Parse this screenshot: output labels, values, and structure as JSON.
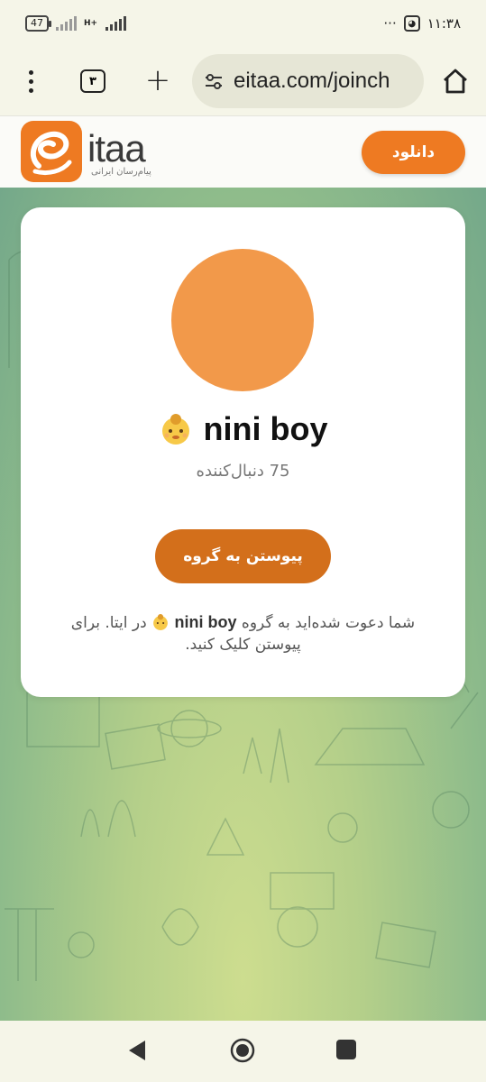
{
  "status_bar": {
    "battery": "47",
    "network_type": "H+",
    "time": "۱۱:۳۸",
    "more": "···"
  },
  "browser": {
    "tab_count": "۳",
    "url": "eitaa.com/joinch",
    "menu_icon": "more-vert-icon",
    "new_tab_icon": "plus-icon",
    "home_icon": "home-icon",
    "site_settings_icon": "tune-icon"
  },
  "site": {
    "logo_word": "itaa",
    "logo_tagline": "پیام‌رسان ایرانی",
    "download_label": "دانلود",
    "accent_color": "#ee7a22"
  },
  "group": {
    "name": "nini boy",
    "emoji_icon": "baby-emoji-icon",
    "avatar_color": "#f2994a",
    "members": "75 دنبال‌کننده",
    "join_label": "پیوستن به گروه",
    "join_color": "#d36f1b",
    "invite_prefix": "شما دعوت شده‌اید به گروه",
    "invite_suffix": "در ایتا. برای پیوستن کلیک کنید."
  },
  "navbar": {
    "back_icon": "back-triangle-icon",
    "home_icon": "home-circle-icon",
    "recents_icon": "recents-square-icon"
  }
}
